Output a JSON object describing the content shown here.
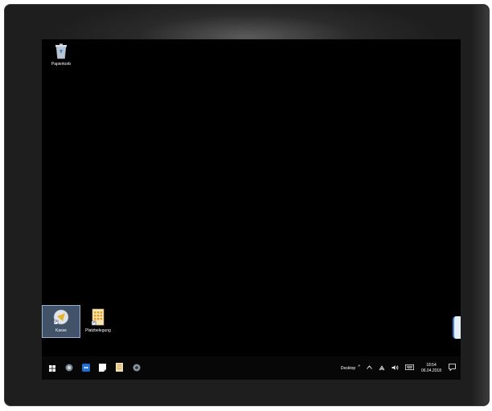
{
  "desktop": {
    "icons": [
      {
        "label": "Papierkorb",
        "icon": "recycle-bin-icon"
      },
      {
        "label": "Kasse",
        "icon": "cash-register-icon",
        "selected": true
      },
      {
        "label": "Platzbelegung",
        "icon": "seat-plan-icon"
      }
    ]
  },
  "taskbar": {
    "pinned": [
      "windows-start-icon",
      "app-round-icon",
      "teamviewer-icon",
      "sticky-notes-icon",
      "document-icon",
      "app-settings-icon"
    ],
    "desktop_label": "Desktop",
    "desktop_chevron": "»",
    "time": "18:54",
    "date": "06.04.2018"
  }
}
